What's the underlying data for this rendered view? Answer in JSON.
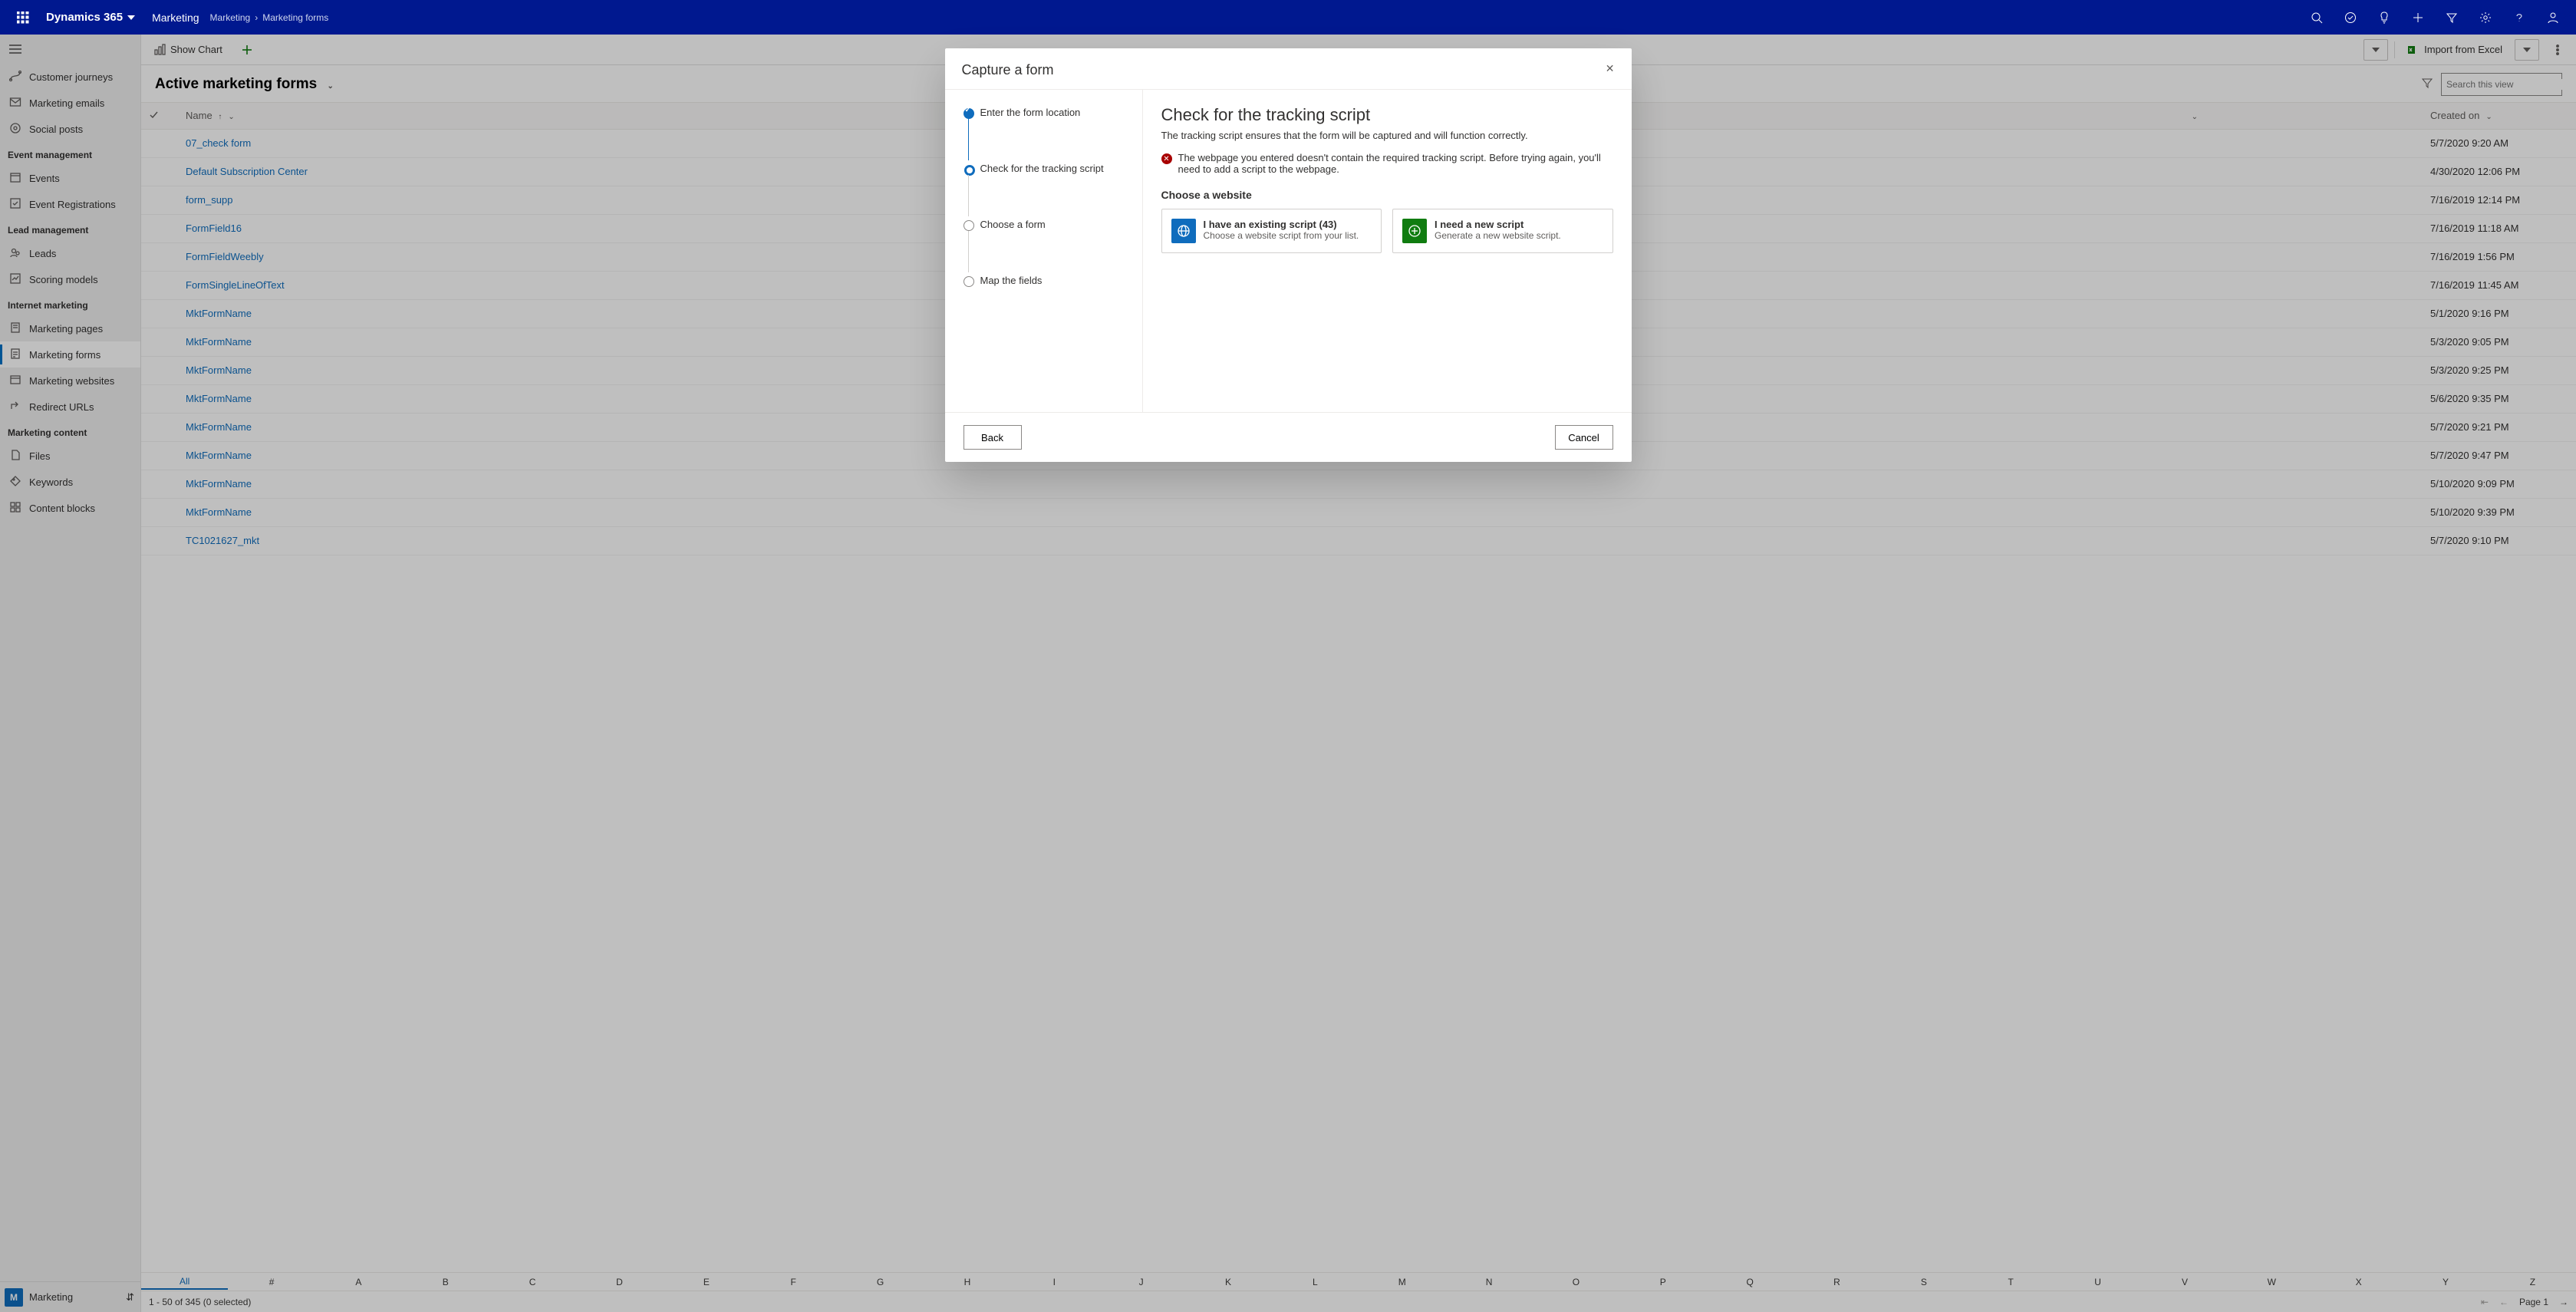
{
  "topnav": {
    "brand": "Dynamics 365",
    "area": "Marketing",
    "crumb1": "Marketing",
    "crumb2": "Marketing forms"
  },
  "sidebar": {
    "sections": [
      {
        "label": "",
        "items": [
          {
            "label": "Customer journeys",
            "icon": "journey"
          },
          {
            "label": "Marketing emails",
            "icon": "mail"
          },
          {
            "label": "Social posts",
            "icon": "social"
          }
        ]
      },
      {
        "label": "Event management",
        "items": [
          {
            "label": "Events",
            "icon": "calendar"
          },
          {
            "label": "Event Registrations",
            "icon": "register"
          }
        ]
      },
      {
        "label": "Lead management",
        "items": [
          {
            "label": "Leads",
            "icon": "leads"
          },
          {
            "label": "Scoring models",
            "icon": "score"
          }
        ]
      },
      {
        "label": "Internet marketing",
        "items": [
          {
            "label": "Marketing pages",
            "icon": "page"
          },
          {
            "label": "Marketing forms",
            "icon": "form",
            "selected": true
          },
          {
            "label": "Marketing websites",
            "icon": "website"
          },
          {
            "label": "Redirect URLs",
            "icon": "redirect"
          }
        ]
      },
      {
        "label": "Marketing content",
        "items": [
          {
            "label": "Files",
            "icon": "files"
          },
          {
            "label": "Keywords",
            "icon": "keywords"
          },
          {
            "label": "Content blocks",
            "icon": "blocks"
          }
        ]
      }
    ],
    "footer": {
      "initial": "M",
      "label": "Marketing"
    }
  },
  "cmdbar": {
    "show_chart": "Show Chart",
    "import_excel": "Import from Excel"
  },
  "view": {
    "title": "Active marketing forms",
    "filter_icon_title": "Filter",
    "search_placeholder": "Search this view"
  },
  "columns": {
    "name": "Name",
    "created": "Created on"
  },
  "rows": [
    {
      "name": "07_check form",
      "created": "5/7/2020 9:20 AM"
    },
    {
      "name": "Default Subscription Center",
      "created": "4/30/2020 12:06 PM"
    },
    {
      "name": "form_supp",
      "created": "7/16/2019 12:14 PM"
    },
    {
      "name": "FormField16",
      "created": "7/16/2019 11:18 AM"
    },
    {
      "name": "FormFieldWeebly",
      "created": "7/16/2019 1:56 PM"
    },
    {
      "name": "FormSingleLineOfText",
      "created": "7/16/2019 11:45 AM"
    },
    {
      "name": "MktFormName",
      "created": "5/1/2020 9:16 PM"
    },
    {
      "name": "MktFormName",
      "created": "5/3/2020 9:05 PM"
    },
    {
      "name": "MktFormName",
      "created": "5/3/2020 9:25 PM"
    },
    {
      "name": "MktFormName",
      "created": "5/6/2020 9:35 PM"
    },
    {
      "name": "MktFormName",
      "created": "5/7/2020 9:21 PM"
    },
    {
      "name": "MktFormName",
      "created": "5/7/2020 9:47 PM"
    },
    {
      "name": "MktFormName",
      "created": "5/10/2020 9:09 PM"
    },
    {
      "name": "MktFormName",
      "created": "5/10/2020 9:39 PM"
    },
    {
      "name": "TC1021627_mkt",
      "created": "5/7/2020 9:10 PM"
    }
  ],
  "alpha": [
    "All",
    "#",
    "A",
    "B",
    "C",
    "D",
    "E",
    "F",
    "G",
    "H",
    "I",
    "J",
    "K",
    "L",
    "M",
    "N",
    "O",
    "P",
    "Q",
    "R",
    "S",
    "T",
    "U",
    "V",
    "W",
    "X",
    "Y",
    "Z"
  ],
  "status": {
    "count": "1 - 50 of 345 (0 selected)",
    "page": "Page 1"
  },
  "modal": {
    "title": "Capture a form",
    "steps": [
      {
        "label": "Enter the form location",
        "state": "done"
      },
      {
        "label": "Check for the tracking script",
        "state": "active"
      },
      {
        "label": "Choose a form",
        "state": "pending"
      },
      {
        "label": "Map the fields",
        "state": "pending"
      }
    ],
    "content": {
      "heading": "Check for the tracking script",
      "sub": "The tracking script ensures that the form will be captured and will function correctly.",
      "error": "The webpage you entered doesn't contain the required tracking script. Before trying again, you'll need to add a script to the webpage.",
      "choose_label": "Choose a website",
      "card1_title": "I have an existing script (43)",
      "card1_desc": "Choose a website script from your list.",
      "card2_title": "I need a new script",
      "card2_desc": "Generate a new website script."
    },
    "buttons": {
      "back": "Back",
      "cancel": "Cancel"
    }
  }
}
